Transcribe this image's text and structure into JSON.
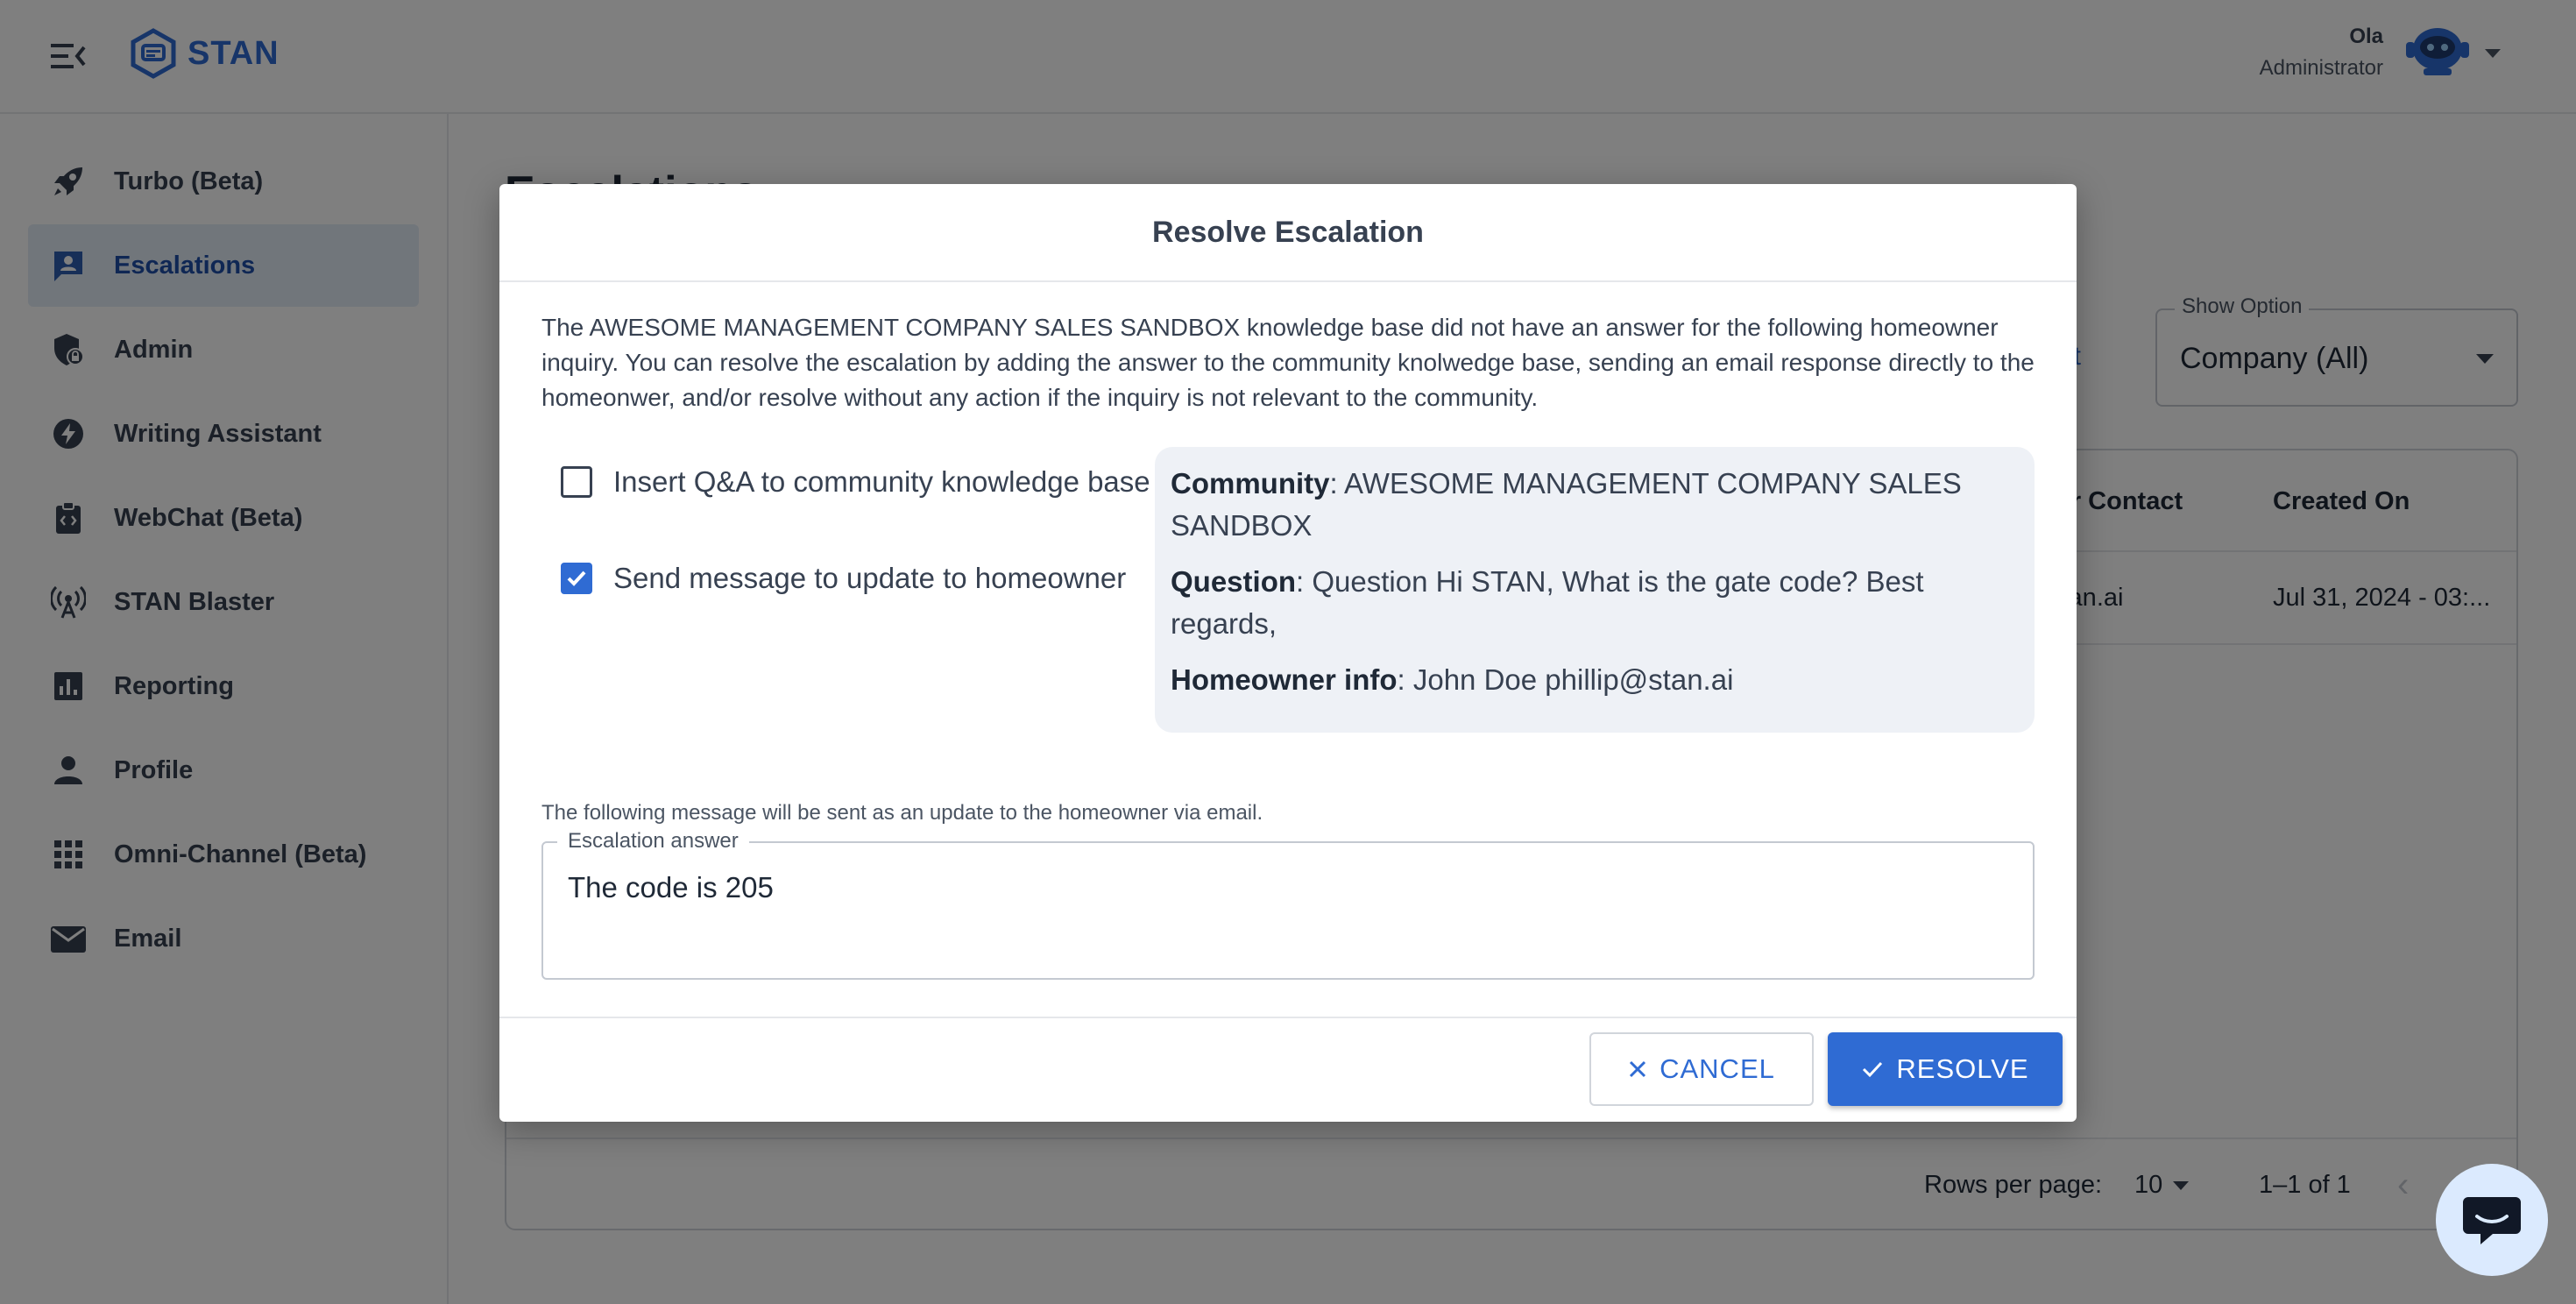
{
  "header": {
    "logo_text": "STAN",
    "user_name": "Ola",
    "user_role": "Administrator"
  },
  "sidebar": {
    "items": [
      {
        "label": "Turbo (Beta)",
        "icon": "rocket-icon"
      },
      {
        "label": "Escalations",
        "icon": "escalations-icon",
        "active": true
      },
      {
        "label": "Admin",
        "icon": "admin-icon"
      },
      {
        "label": "Writing Assistant",
        "icon": "bolt-icon"
      },
      {
        "label": "WebChat (Beta)",
        "icon": "webchat-icon"
      },
      {
        "label": "STAN Blaster",
        "icon": "broadcast-icon"
      },
      {
        "label": "Reporting",
        "icon": "chart-icon"
      },
      {
        "label": "Profile",
        "icon": "person-icon"
      },
      {
        "label": "Omni-Channel (Beta)",
        "icon": "grid-icon"
      },
      {
        "label": "Email",
        "icon": "mail-icon"
      }
    ]
  },
  "main": {
    "page_title": "Escalations",
    "report_link": "ort",
    "show_option": {
      "label": "Show Option",
      "value": "Company (All)"
    },
    "table": {
      "headers": [
        "ger Contact",
        "Created On"
      ],
      "rows": [
        {
          "contact": "stan.ai",
          "created": "Jul 31, 2024 - 03:..."
        }
      ]
    },
    "pagination": {
      "rows_per_page_label": "Rows per page:",
      "rows_per_page_value": "10",
      "range": "1–1 of 1"
    }
  },
  "modal": {
    "title": "Resolve Escalation",
    "intro": "The AWESOME MANAGEMENT COMPANY SALES SANDBOX knowledge base did not have an answer for the following homeowner inquiry. You can resolve the escalation by adding the answer to the community knolwedge base, sending an email response directly to the homeonwer, and/or resolve without any action if the inquiry is not relevant to the community.",
    "options": [
      {
        "label": "Insert Q&A to community knowledge base",
        "checked": false
      },
      {
        "label": "Send message to update to homeowner",
        "checked": true
      }
    ],
    "info": {
      "community_key": "Community",
      "community_value": ": AWESOME MANAGEMENT COMPANY SALES SANDBOX",
      "question_key": "Question",
      "question_value": ": Question Hi STAN, What is the gate code? Best regards,",
      "homeowner_key": "Homeowner info",
      "homeowner_value": ": John Doe phillip@stan.ai"
    },
    "help_text": "The following message will be sent as an update to the homeowner via email.",
    "answer_label": "Escalation answer",
    "answer_value": "The code is 205",
    "cancel_label": "CANCEL",
    "resolve_label": "RESOLVE"
  },
  "colors": {
    "accent": "#2f6bd3",
    "active_nav_bg": "#e3ecf7",
    "overlay": "rgba(0,0,0,0.5)"
  }
}
